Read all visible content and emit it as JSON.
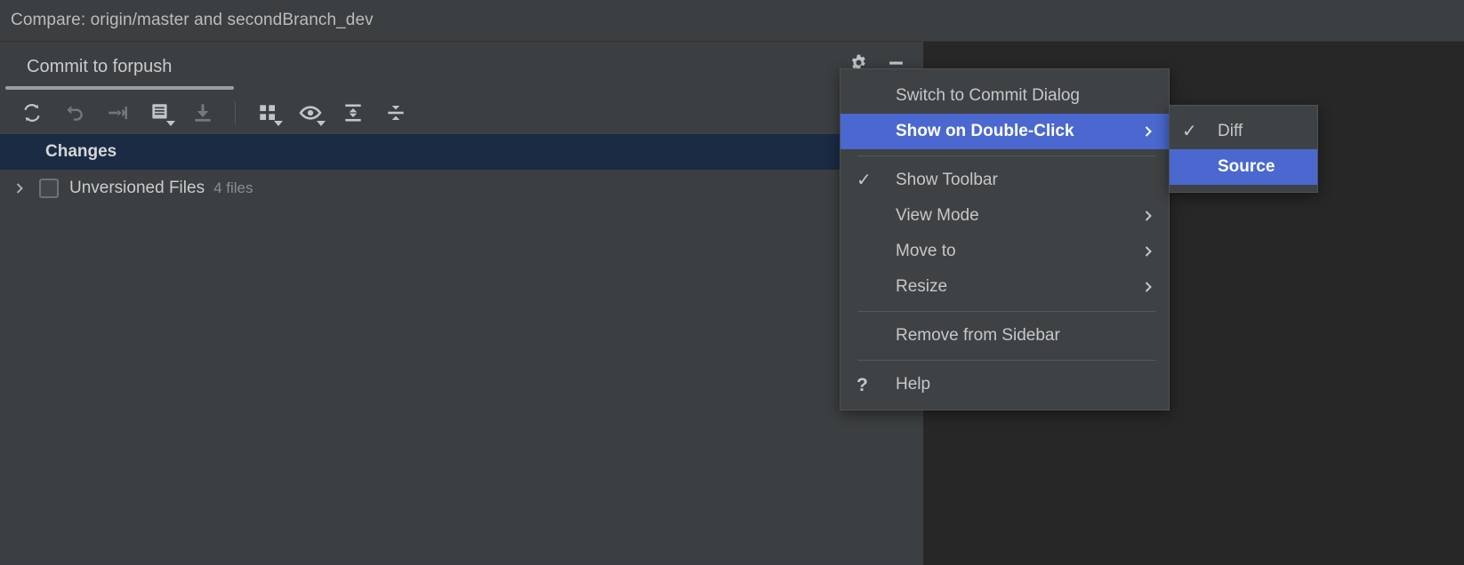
{
  "window": {
    "title": "Compare: origin/master and secondBranch_dev"
  },
  "toolwindow": {
    "tab_label": "Commit to forpush",
    "actions": [
      {
        "name": "settings-gear-icon",
        "label": "Settings"
      },
      {
        "name": "hide-icon",
        "label": "Hide"
      }
    ],
    "toolbar": [
      {
        "name": "refresh-icon",
        "label": "Refresh Changes",
        "enabled": true,
        "dropdown": false
      },
      {
        "name": "rollback-icon",
        "label": "Rollback",
        "enabled": false,
        "dropdown": false
      },
      {
        "name": "shelve-icon",
        "label": "Shelve Silently",
        "enabled": false,
        "dropdown": false
      },
      {
        "name": "commit-message-icon",
        "label": "Commit Message History",
        "enabled": true,
        "dropdown": true
      },
      {
        "name": "update-project-icon",
        "label": "Update Project",
        "enabled": false,
        "dropdown": false
      },
      {
        "name": "group-by-icon",
        "label": "Group By",
        "enabled": true,
        "dropdown": true
      },
      {
        "name": "preview-diff-icon",
        "label": "Preview Diff",
        "enabled": true,
        "dropdown": true
      },
      {
        "name": "expand-all-icon",
        "label": "Expand All",
        "enabled": true,
        "dropdown": false
      },
      {
        "name": "collapse-all-icon",
        "label": "Collapse All",
        "enabled": true,
        "dropdown": false
      }
    ]
  },
  "changes": {
    "header": "Changes",
    "rows": [
      {
        "label": "Unversioned Files",
        "count": "4 files",
        "expanded": false,
        "checked": false
      }
    ]
  },
  "context_menu": {
    "items": [
      {
        "label": "Switch to Commit Dialog",
        "checked": false,
        "submenu": false,
        "selected": false,
        "icon": ""
      },
      {
        "label": "Show on Double-Click",
        "checked": false,
        "submenu": true,
        "selected": true,
        "icon": ""
      },
      {
        "separator": true
      },
      {
        "label": "Show Toolbar",
        "checked": true,
        "submenu": false,
        "selected": false,
        "icon": "check-icon"
      },
      {
        "label": "View Mode",
        "checked": false,
        "submenu": true,
        "selected": false,
        "icon": ""
      },
      {
        "label": "Move to",
        "checked": false,
        "submenu": true,
        "selected": false,
        "icon": ""
      },
      {
        "label": "Resize",
        "checked": false,
        "submenu": true,
        "selected": false,
        "icon": ""
      },
      {
        "separator": true
      },
      {
        "label": "Remove from Sidebar",
        "checked": false,
        "submenu": false,
        "selected": false,
        "icon": ""
      },
      {
        "separator": true
      },
      {
        "label": "Help",
        "checked": false,
        "submenu": false,
        "selected": false,
        "icon": "help-icon"
      }
    ]
  },
  "submenu": {
    "items": [
      {
        "label": "Diff",
        "checked": true,
        "selected": false
      },
      {
        "label": "Source",
        "checked": false,
        "selected": true
      }
    ]
  },
  "colors": {
    "background": "#3c3f41",
    "dark_panel": "#272727",
    "selection_blue": "#4a68cf",
    "changes_row": "#1b2b43",
    "menu_background": "#3f4244",
    "text": "#c5c7c9",
    "muted_text": "#8a8e91"
  }
}
